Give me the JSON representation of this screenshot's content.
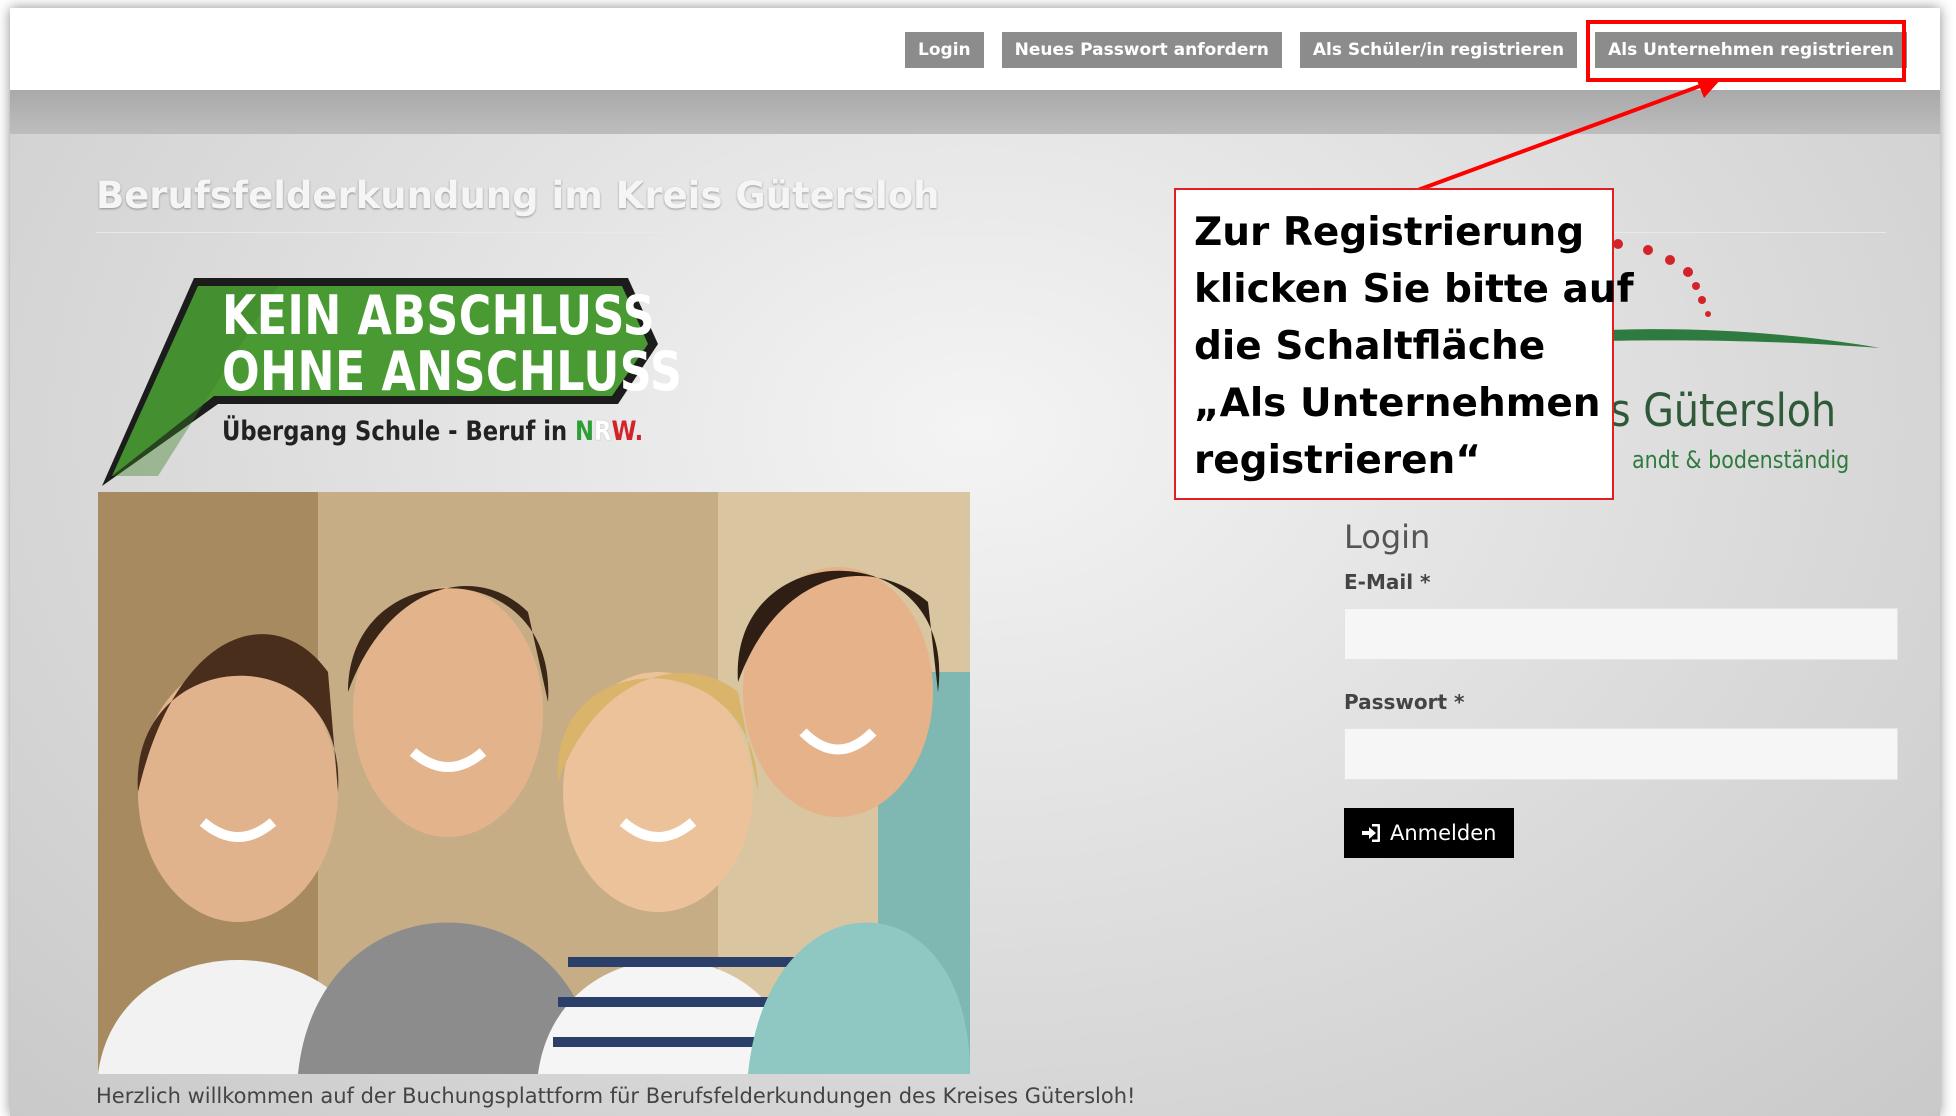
{
  "topnav": {
    "items": [
      {
        "label": "Login"
      },
      {
        "label": "Neues Passwort anfordern"
      },
      {
        "label": "Als Schüler/in registrieren"
      },
      {
        "label": "Als Unternehmen registrieren"
      }
    ]
  },
  "site_title": "Berufsfelderkundung im Kreis Gütersloh",
  "kao_logo": {
    "line1": "KEIN ABSCHLUSS",
    "line2": "OHNE ANSCHLUSS",
    "sub_prefix": "Übergang Schule - Beruf in ",
    "sub_n": "N",
    "sub_r": "R",
    "sub_w": "W."
  },
  "kreis_logo": {
    "name": "s Gütersloh",
    "slogan": "andt & bodenständig"
  },
  "login": {
    "title": "Login",
    "email_label": "E-Mail *",
    "email_value": "",
    "password_label": "Passwort *",
    "password_value": "",
    "submit_label": "Anmelden"
  },
  "welcome_text": "Herzlich willkommen auf der Buchungsplattform für Berufsfelderkundungen des Kreises Gütersloh!",
  "annotation": {
    "lines": [
      "Zur Registrierung",
      "klicken Sie bitte auf",
      "die Schaltfläche",
      "„Als Unternehmen",
      "registrieren“"
    ]
  },
  "colors": {
    "nav_button": "#8c8c8c",
    "annotation_red": "#ff0000",
    "kao_green": "#4a9a34",
    "submit_bg": "#000000"
  }
}
